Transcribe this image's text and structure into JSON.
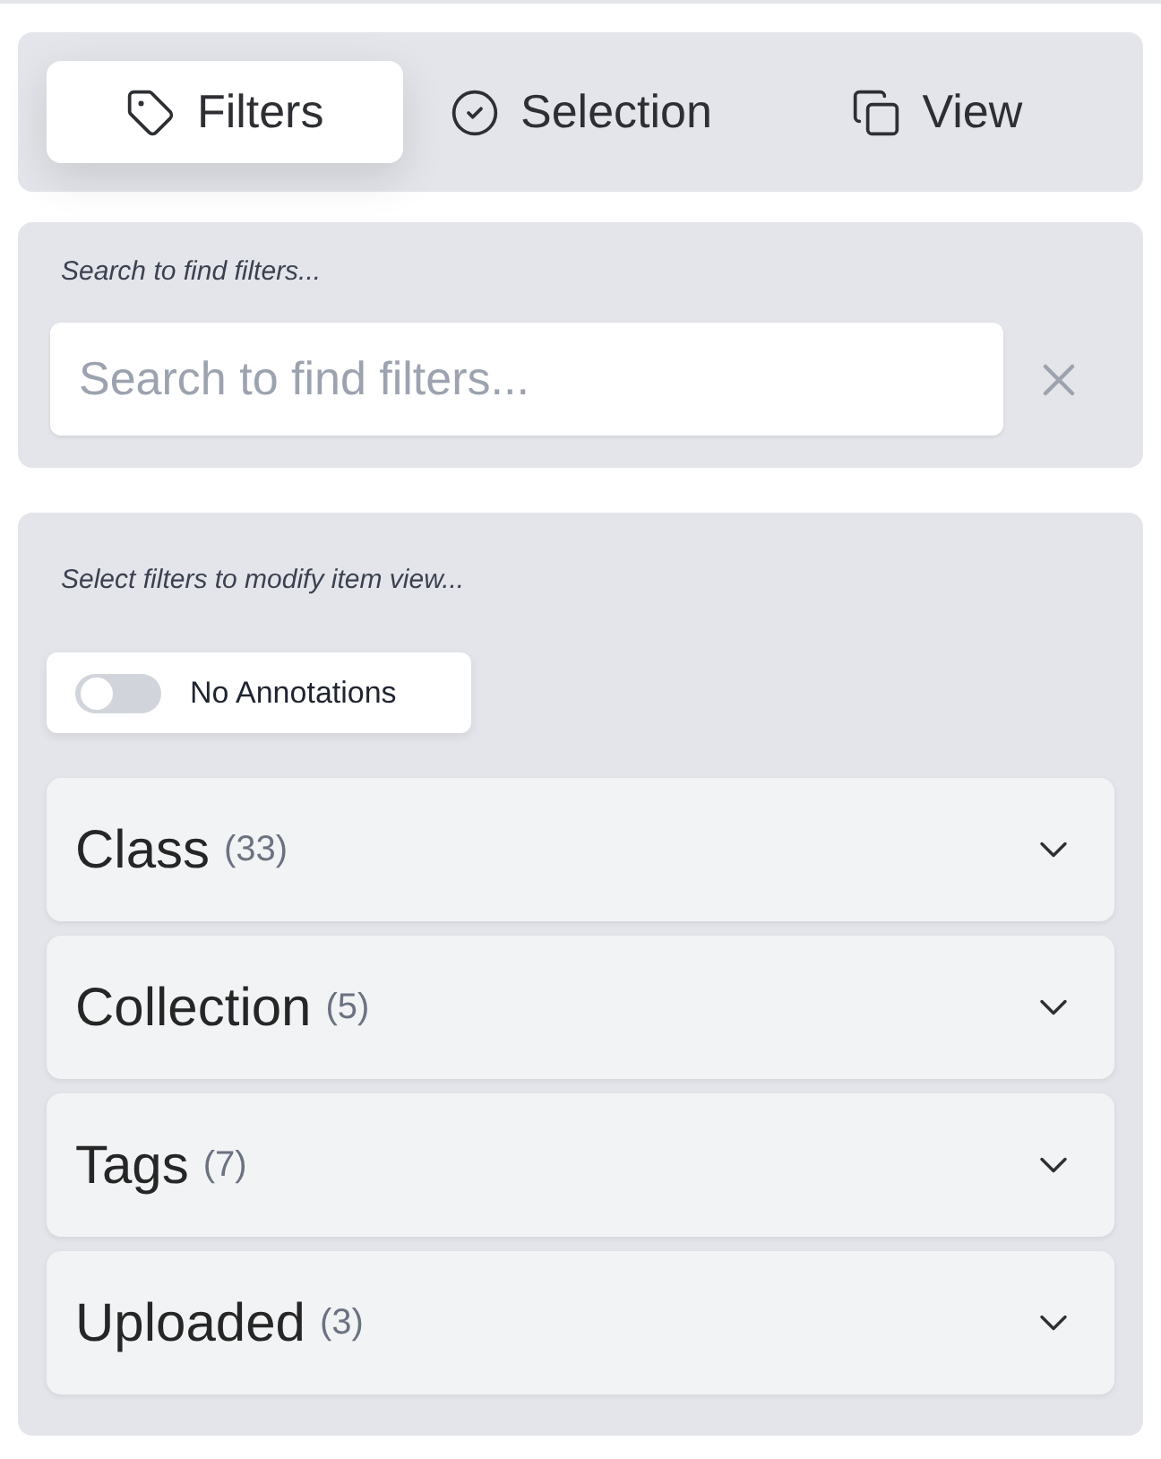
{
  "tabs": [
    {
      "label": "Filters",
      "kind": "tag",
      "selected": true
    },
    {
      "label": "Selection",
      "kind": "check",
      "selected": false
    },
    {
      "label": "View",
      "kind": "copy",
      "selected": false
    }
  ],
  "search": {
    "label": "Search to find filters...",
    "placeholder": "Search to find filters..."
  },
  "filters": {
    "hint": "Select filters to modify item view...",
    "toggle": {
      "label": "No Annotations",
      "on": false
    },
    "groups": [
      {
        "name": "Class",
        "count": "(33)",
        "expanded": false
      },
      {
        "name": "Collection",
        "count": "(5)",
        "expanded": false
      },
      {
        "name": "Tags",
        "count": "(7)",
        "expanded": false
      },
      {
        "name": "Uploaded",
        "count": "(3)",
        "expanded": false
      }
    ]
  }
}
